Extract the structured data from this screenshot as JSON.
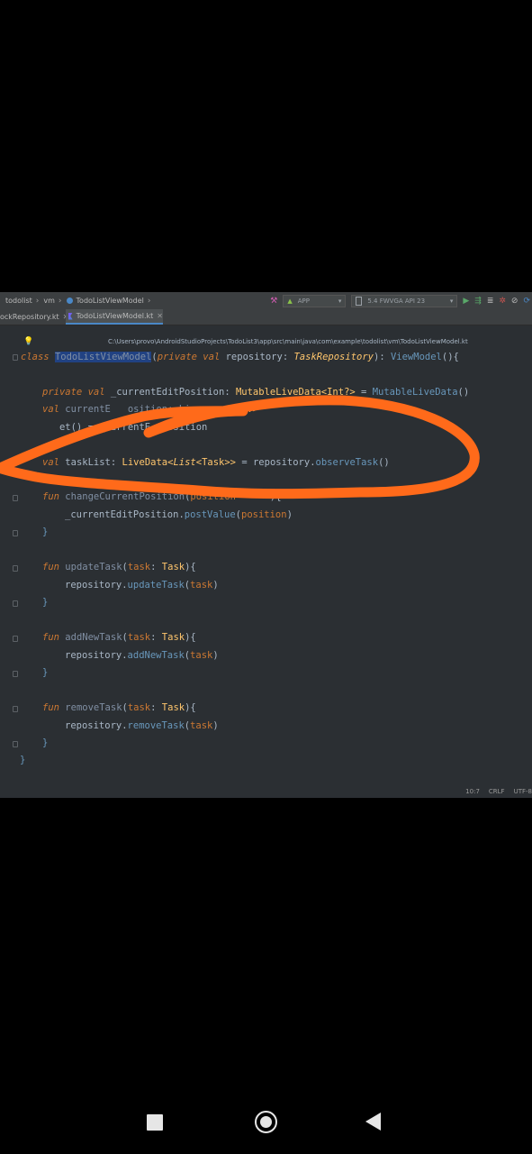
{
  "breadcrumb": {
    "items": [
      "todolist",
      "vm",
      "TodoListViewModel"
    ]
  },
  "toolbar": {
    "app_config": "APP",
    "device": "5.4  FWVGA API 23"
  },
  "tabs": [
    {
      "label": "ockRepository.kt",
      "active": false
    },
    {
      "label": "TodoListViewModel.kt",
      "active": true
    }
  ],
  "file_path": "C:\\Users\\provo\\AndroidStudioProjects\\TodoList3\\app\\src\\main\\java\\com\\example\\todolist\\vm\\TodoListViewModel.kt",
  "code": {
    "class_kw": "class",
    "class_name": "TodoListViewModel",
    "ctor_kw": "private val",
    "ctor_param": "repository",
    "ctor_type": "TaskRepository",
    "super_call": "ViewModel",
    "l_private": "private val",
    "l_current_edit": "_currentEditPosition",
    "l_mutable_type": "MutableLiveData<Int?>",
    "l_mutable_init": "MutableLiveData",
    "l_val": "val",
    "l_current_pos": "currentE",
    "l_current_pos_rest": "osition: Liv",
    "l_int_frag": "Int?>",
    "l_get_frag": "et() = _currentE",
    "l_get_frag_rest": "osition",
    "l_tasklist_val": "val",
    "l_tasklist": "taskList",
    "l_livedata": "LiveData",
    "l_list": "List",
    "l_task": "Task",
    "l_repo": "repository",
    "l_observe": "observeTask",
    "fun1_kw": "fun",
    "fun1_name": "changeCurrentPosition",
    "fun1_param": "position",
    "fun1_body_obj": "_currentEditPosition",
    "fun1_body_call": "postValue",
    "fun1_body_arg": "position",
    "fun2_kw": "fun",
    "fun2_name": "updateTask",
    "fun2_param": "task",
    "fun2_type": "Task",
    "fun2_obj": "repository",
    "fun2_call": "updateTask",
    "fun2_arg": "task",
    "fun3_kw": "fun",
    "fun3_name": "addNewTask",
    "fun3_param": "task",
    "fun3_type": "Task",
    "fun3_obj": "repository",
    "fun3_call": "addNewTask",
    "fun3_arg": "task",
    "fun4_kw": "fun",
    "fun4_name": "removeTask",
    "fun4_param": "task",
    "fun4_type": "Task",
    "fun4_obj": "repository",
    "fun4_call": "removeTask",
    "fun4_arg": "task"
  },
  "status_bar": {
    "position": "10:7",
    "line_sep": "CRLF",
    "encoding": "UTF-8"
  },
  "colors": {
    "annotation_stroke": "#ff6a1a",
    "editor_bg": "#2b2f33"
  }
}
